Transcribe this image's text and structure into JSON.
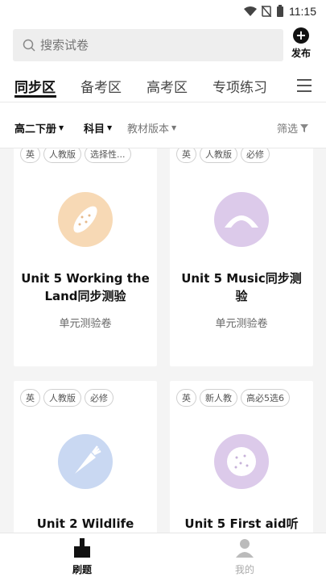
{
  "status": {
    "time": "11:15"
  },
  "search": {
    "placeholder": "搜索试卷"
  },
  "publish": {
    "label": "发布"
  },
  "tabs": [
    {
      "label": "同步区",
      "active": true
    },
    {
      "label": "备考区",
      "active": false
    },
    {
      "label": "高考区",
      "active": false
    },
    {
      "label": "专项练习",
      "active": false
    }
  ],
  "filters": {
    "grade": "高二下册",
    "subject": "科目",
    "edition": "教材版本",
    "screen": "筛选"
  },
  "cards": [
    {
      "tags": [
        "英",
        "人教版",
        "选择性..."
      ],
      "title": "Unit 5 Working the Land同步测验",
      "subtitle": "单元测验卷",
      "icon": "peanut-icon",
      "icon_color": "#f7d9b5"
    },
    {
      "tags": [
        "英",
        "人教版",
        "必修"
      ],
      "title": "Unit 5 Music同步测验",
      "subtitle": "单元测验卷",
      "icon": "rainbow-icon",
      "icon_color": "#dccaea"
    },
    {
      "tags": [
        "英",
        "人教版",
        "必修"
      ],
      "title": "Unit 2 Wildlife",
      "subtitle": "",
      "icon": "carrot-icon",
      "icon_color": "#c9d8f2"
    },
    {
      "tags": [
        "英",
        "新人教",
        "高必5选6"
      ],
      "title": "Unit 5 First aid听",
      "subtitle": "",
      "icon": "cookie-icon",
      "icon_color": "#dccaea"
    }
  ],
  "bottom_nav": [
    {
      "label": "刷题",
      "active": true
    },
    {
      "label": "我的",
      "active": false
    }
  ]
}
